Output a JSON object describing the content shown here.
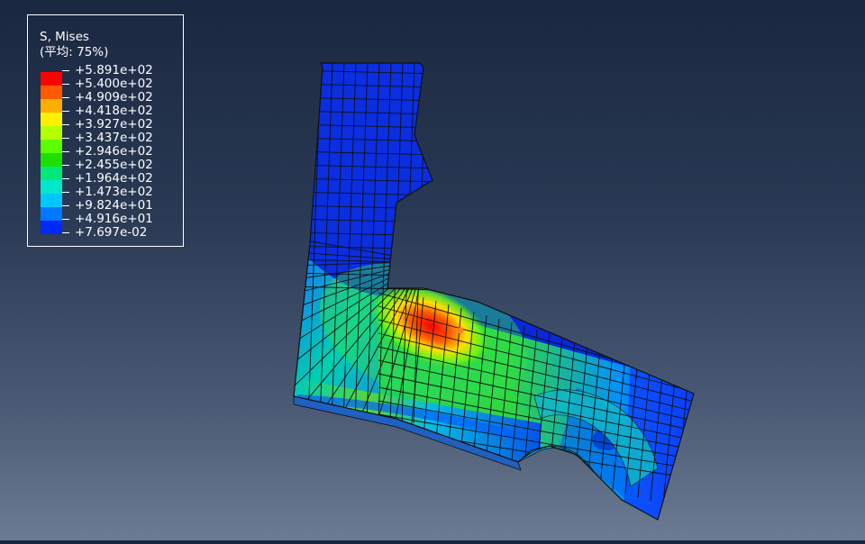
{
  "legend": {
    "title_line1": "S, Mises",
    "title_line2": "(平均: 75%)",
    "levels": [
      {
        "label": "+5.891e+02"
      },
      {
        "label": "+5.400e+02"
      },
      {
        "label": "+4.909e+02"
      },
      {
        "label": "+4.418e+02"
      },
      {
        "label": "+3.927e+02"
      },
      {
        "label": "+3.437e+02"
      },
      {
        "label": "+2.946e+02"
      },
      {
        "label": "+2.455e+02"
      },
      {
        "label": "+1.964e+02"
      },
      {
        "label": "+1.473e+02"
      },
      {
        "label": "+9.824e+01"
      },
      {
        "label": "+4.916e+01"
      },
      {
        "label": "+7.697e-02"
      }
    ],
    "band_colors": [
      "#ff0000",
      "#ff5a00",
      "#ffae00",
      "#fff000",
      "#b4ff00",
      "#5cff00",
      "#1ee000",
      "#00e87a",
      "#00e8cc",
      "#00c8ff",
      "#0078ff",
      "#0028ff"
    ]
  },
  "colors": {
    "mesh_line": "#101010",
    "blue": "#1030e0",
    "red": "#ff1000"
  }
}
